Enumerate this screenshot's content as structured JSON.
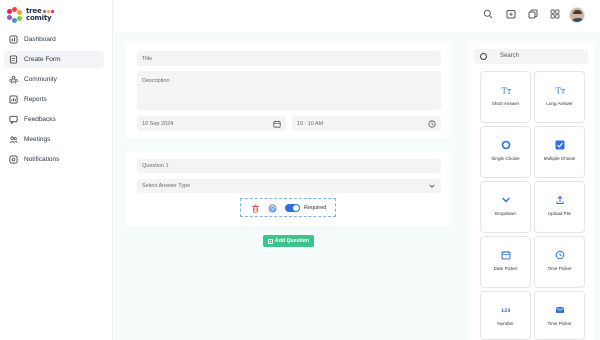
{
  "brand": {
    "line1": "tree",
    "line2": "comity"
  },
  "nav": [
    {
      "label": "Dashboard",
      "icon": "dashboard-icon"
    },
    {
      "label": "Create Form",
      "icon": "form-icon",
      "active": true
    },
    {
      "label": "Community",
      "icon": "community-icon"
    },
    {
      "label": "Reports",
      "icon": "reports-icon"
    },
    {
      "label": "Feedbacks",
      "icon": "feedback-icon"
    },
    {
      "label": "Meetings",
      "icon": "meetings-icon"
    },
    {
      "label": "Notifications",
      "icon": "notifications-icon"
    }
  ],
  "header": {
    "icons": [
      "search-icon",
      "add-doc-icon",
      "copy-icon",
      "apps-grid-icon"
    ]
  },
  "form": {
    "title_placeholder": "Title",
    "description_placeholder": "Description",
    "date_value": "10 Sep 2024",
    "time_value": "10 : 10 AM"
  },
  "question": {
    "label": "Question 1",
    "answer_type_placeholder": "Select Answer Type",
    "required_label": "Required",
    "required_on": true
  },
  "add_question_label": "Add Question",
  "palette": {
    "search_placeholder": "Search",
    "items": [
      {
        "label": "Short Answer",
        "icon": "text-icon"
      },
      {
        "label": "Long Answer",
        "icon": "text-icon"
      },
      {
        "label": "Single Choise",
        "icon": "radio-icon"
      },
      {
        "label": "Multiple Choise",
        "icon": "checkbox-icon"
      },
      {
        "label": "Dropdown",
        "icon": "chevron-down-icon"
      },
      {
        "label": "Upload File",
        "icon": "upload-icon"
      },
      {
        "label": "Date Picker",
        "icon": "calendar-icon"
      },
      {
        "label": "Time Picker",
        "icon": "clock-icon"
      },
      {
        "label": "Number",
        "icon": "number-icon"
      },
      {
        "label": "Time Picker",
        "icon": "mail-icon"
      }
    ]
  },
  "colors": {
    "accent": "#2f6fe4",
    "success": "#3ec38a",
    "danger": "#e04b4b"
  }
}
